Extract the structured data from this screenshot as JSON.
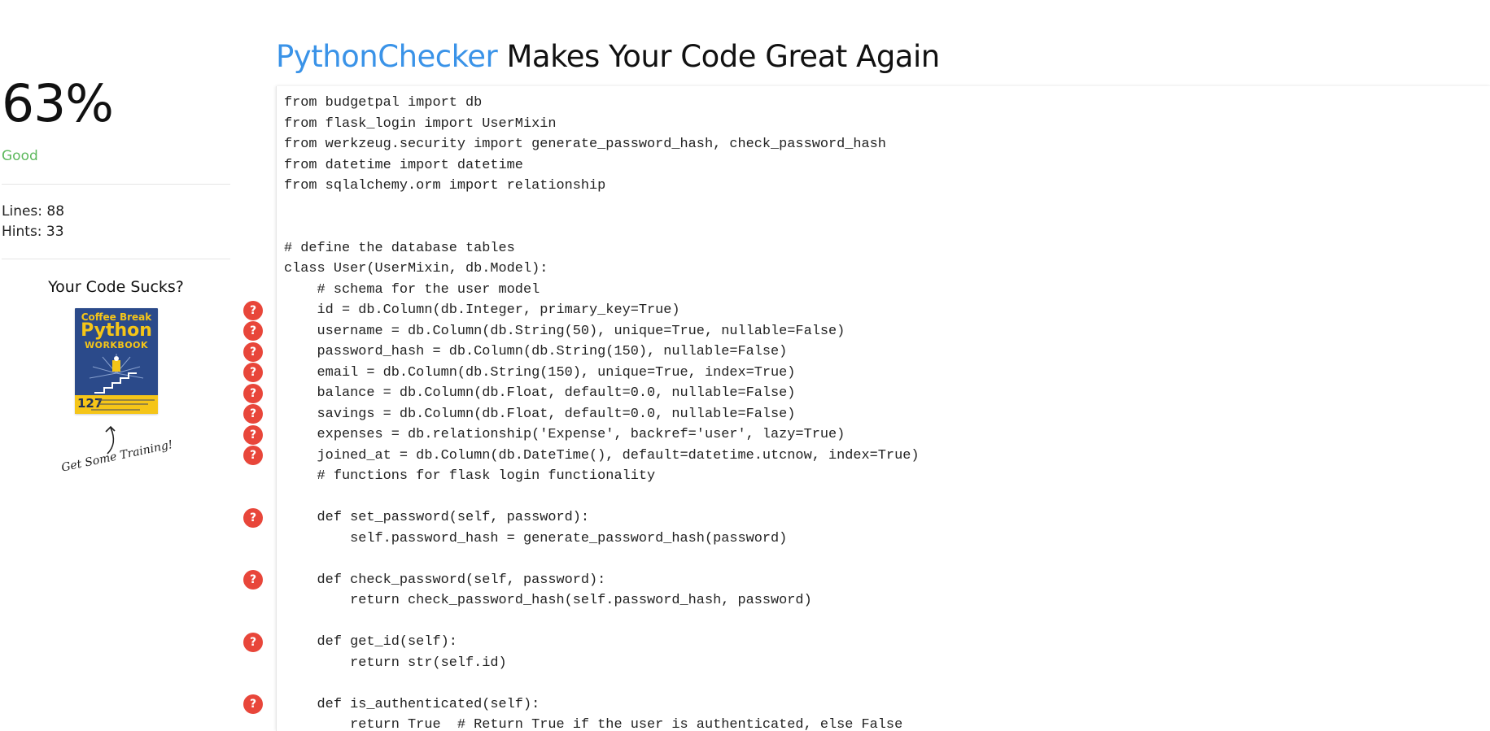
{
  "sidebar": {
    "score": "63%",
    "rating": "Good",
    "rating_color": "#5cb85c",
    "lines": "Lines: 88",
    "hints": "Hints: 33",
    "promo_title": "Your Code Sucks?",
    "book": {
      "line1": "Coffee Break",
      "line2": "Python",
      "line3": "WORKBOOK",
      "number": "127"
    },
    "training_caption": "Get Some Training!"
  },
  "header": {
    "brand": "PythonChecker",
    "tagline": " Makes Your Code Great Again",
    "brand_color": "#3a93e8"
  },
  "code": {
    "lines": [
      "from budgetpal import db",
      "from flask_login import UserMixin",
      "from werkzeug.security import generate_password_hash, check_password_hash",
      "from datetime import datetime",
      "from sqlalchemy.orm import relationship",
      "",
      "",
      "# define the database tables",
      "class User(UserMixin, db.Model):",
      "    # schema for the user model",
      "    id = db.Column(db.Integer, primary_key=True)",
      "    username = db.Column(db.String(50), unique=True, nullable=False)",
      "    password_hash = db.Column(db.String(150), nullable=False)",
      "    email = db.Column(db.String(150), unique=True, index=True)",
      "    balance = db.Column(db.Float, default=0.0, nullable=False)",
      "    savings = db.Column(db.Float, default=0.0, nullable=False)",
      "    expenses = db.relationship('Expense', backref='user', lazy=True)",
      "    joined_at = db.Column(db.DateTime(), default=datetime.utcnow, index=True)",
      "    # functions for flask login functionality",
      "",
      "    def set_password(self, password):",
      "        self.password_hash = generate_password_hash(password)",
      "",
      "    def check_password(self, password):",
      "        return check_password_hash(self.password_hash, password)",
      "",
      "    def get_id(self):",
      "        return str(self.id)",
      "",
      "    def is_authenticated(self):",
      "        return True  # Return True if the user is authenticated, else False"
    ],
    "hint_marker": "?",
    "hint_color": "#e8463a"
  }
}
